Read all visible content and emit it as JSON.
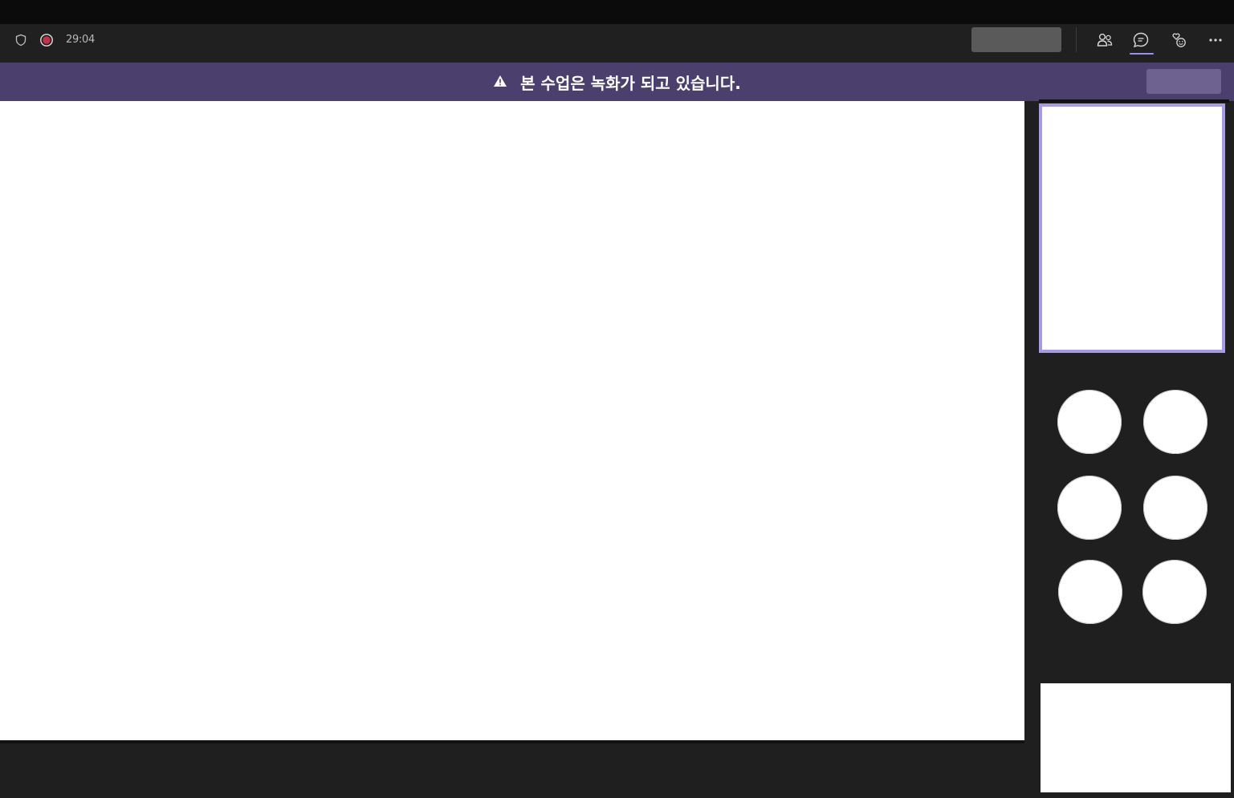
{
  "toolbar": {
    "timer": "29:04",
    "leave_button_label": "",
    "icons": [
      "shield-icon",
      "record-icon",
      "people-icon",
      "chat-icon",
      "reactions-icon",
      "more-icon"
    ],
    "active_tab": "chat"
  },
  "banner": {
    "message": "본 수업은 녹화가 되고 있습니다.",
    "icon": "warning-icon",
    "button_label": ""
  },
  "colors": {
    "accent": "#9a8ff0",
    "banner_bg": "#4a3f6d",
    "recording": "#c4314b",
    "toolbar_bg": "#202020"
  },
  "participants": {
    "count": 6
  }
}
